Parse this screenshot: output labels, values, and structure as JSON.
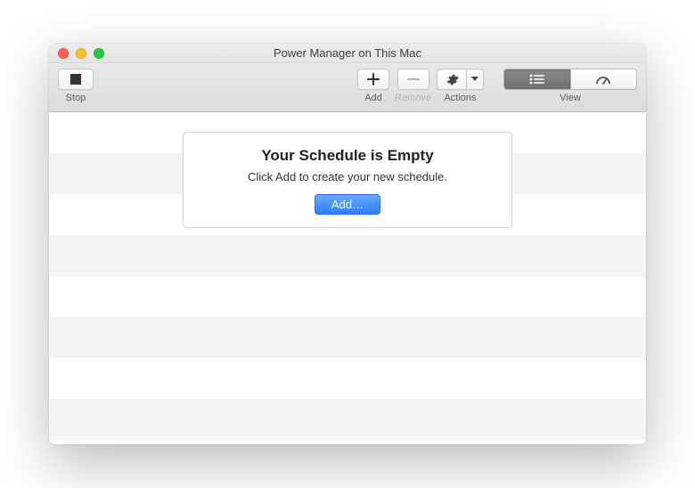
{
  "window": {
    "title": "Power Manager on This Mac"
  },
  "toolbar": {
    "stop_label": "Stop",
    "add_label": "Add",
    "remove_label": "Remove",
    "actions_label": "Actions",
    "view_label": "View"
  },
  "empty_state": {
    "title": "Your Schedule is Empty",
    "subtitle": "Click Add to create your new schedule.",
    "button_label": "Add…"
  }
}
